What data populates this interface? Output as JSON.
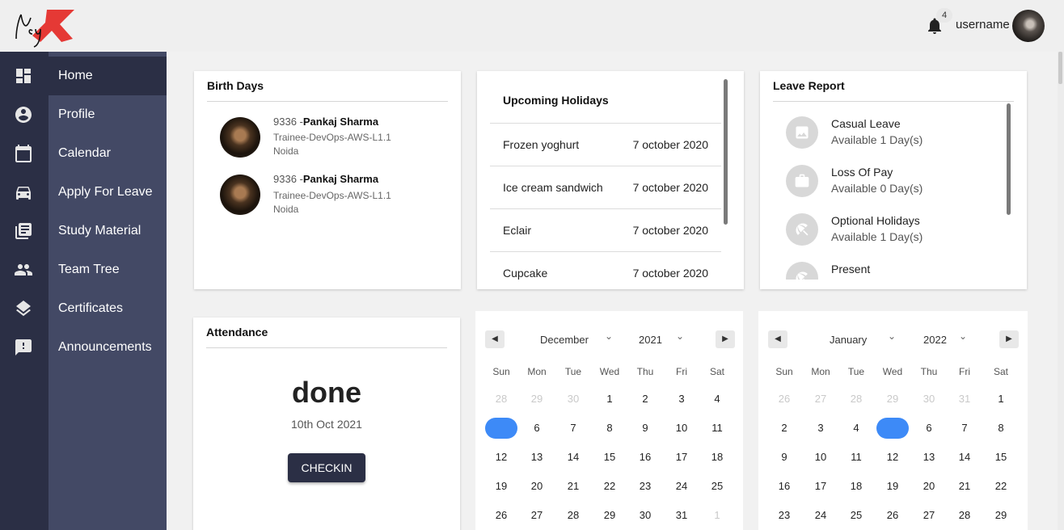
{
  "header": {
    "logo_text": "Ncy",
    "notifications_count": "4",
    "username": "username"
  },
  "sidebar": {
    "items": [
      {
        "label": "Home",
        "icon": "dashboard-icon"
      },
      {
        "label": "Profile",
        "icon": "account-circle-icon"
      },
      {
        "label": "Calendar",
        "icon": "calendar-icon"
      },
      {
        "label": "Apply For Leave",
        "icon": "car-icon"
      },
      {
        "label": "Study Material",
        "icon": "library-books-icon"
      },
      {
        "label": "Team Tree",
        "icon": "people-icon"
      },
      {
        "label": "Certificates",
        "icon": "layers-icon"
      },
      {
        "label": "Announcements",
        "icon": "feedback-icon"
      }
    ],
    "active": "Home"
  },
  "birthdays": {
    "title": "Birth Days",
    "people": [
      {
        "id": "9336 -",
        "name": "Pankaj Sharma",
        "role": "Trainee-DevOps-AWS-L1.1",
        "location": "Noida"
      },
      {
        "id": "9336 -",
        "name": "Pankaj Sharma",
        "role": "Trainee-DevOps-AWS-L1.1",
        "location": "Noida"
      }
    ]
  },
  "holidays": {
    "title": "Upcoming Holidays",
    "rows": [
      {
        "name": "Frozen yoghurt",
        "date": "7 october 2020"
      },
      {
        "name": "Ice cream sandwich",
        "date": "7 october 2020"
      },
      {
        "name": "Eclair",
        "date": "7 october 2020"
      },
      {
        "name": "Cupcake",
        "date": "7 october 2020"
      }
    ]
  },
  "leave_report": {
    "title": "Leave Report",
    "items": [
      {
        "name": "Casual Leave",
        "available": "Available 1 Day(s)",
        "icon": "image-icon"
      },
      {
        "name": "Loss Of Pay",
        "available": "Available 0 Day(s)",
        "icon": "briefcase-icon"
      },
      {
        "name": "Optional Holidays",
        "available": "Available 1 Day(s)",
        "icon": "beach-icon"
      },
      {
        "name": "Present",
        "available": "",
        "icon": "beach-icon"
      }
    ]
  },
  "attendance": {
    "title": "Attendance",
    "status": "done",
    "date": "10th Oct 2021",
    "button_label": "CHECKIN"
  },
  "calendars": [
    {
      "month": "December",
      "year": "2021",
      "weekdays": [
        "Sun",
        "Mon",
        "Tue",
        "Wed",
        "Thu",
        "Fri",
        "Sat"
      ],
      "weeks": [
        [
          "28",
          "29",
          "30",
          "1",
          "2",
          "3",
          "4"
        ],
        [
          "",
          "6",
          "7",
          "8",
          "9",
          "10",
          "11"
        ],
        [
          "12",
          "13",
          "14",
          "15",
          "16",
          "17",
          "18"
        ],
        [
          "19",
          "20",
          "21",
          "22",
          "23",
          "24",
          "25"
        ],
        [
          "26",
          "27",
          "28",
          "29",
          "30",
          "31",
          "1"
        ]
      ],
      "muted": [
        [
          0,
          0
        ],
        [
          0,
          1
        ],
        [
          0,
          2
        ],
        [
          4,
          6
        ]
      ],
      "selected": [
        1,
        0
      ]
    },
    {
      "month": "January",
      "year": "2022",
      "weekdays": [
        "Sun",
        "Mon",
        "Tue",
        "Wed",
        "Thu",
        "Fri",
        "Sat"
      ],
      "weeks": [
        [
          "26",
          "27",
          "28",
          "29",
          "30",
          "31",
          "1"
        ],
        [
          "2",
          "3",
          "4",
          "",
          "6",
          "7",
          "8"
        ],
        [
          "9",
          "10",
          "11",
          "12",
          "13",
          "14",
          "15"
        ],
        [
          "16",
          "17",
          "18",
          "19",
          "20",
          "21",
          "22"
        ],
        [
          "23",
          "24",
          "25",
          "26",
          "27",
          "28",
          "29"
        ]
      ],
      "muted": [
        [
          0,
          0
        ],
        [
          0,
          1
        ],
        [
          0,
          2
        ],
        [
          0,
          3
        ],
        [
          0,
          4
        ],
        [
          0,
          5
        ]
      ],
      "selected": [
        1,
        3
      ]
    }
  ],
  "colors": {
    "rail": "#2b2f45",
    "menu": "#434965",
    "accent": "#3d8af7",
    "logo_red": "#e53935"
  }
}
